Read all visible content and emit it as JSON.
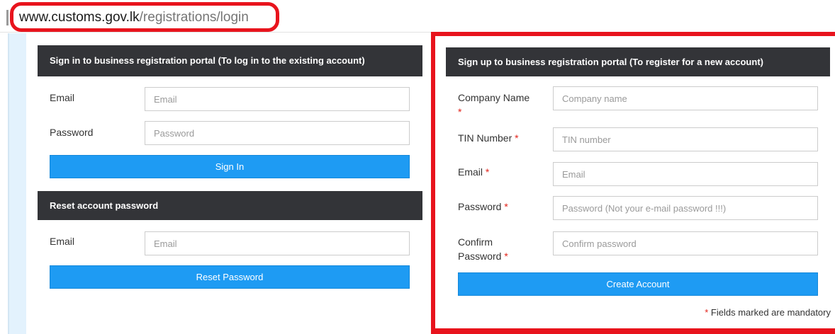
{
  "browser": {
    "url_host": "www.customs.gov.lk",
    "url_path": "/registrations/login"
  },
  "signin": {
    "title": "Sign in to business registration portal (To log in to the existing account)",
    "email_label": "Email",
    "email_placeholder": "Email",
    "password_label": "Password",
    "password_placeholder": "Password",
    "button": "Sign In"
  },
  "reset": {
    "title": "Reset account password",
    "email_label": "Email",
    "email_placeholder": "Email",
    "button": "Reset Password"
  },
  "signup": {
    "title": "Sign up to business registration portal (To register for a new account)",
    "required_mark": "*",
    "company_label": "Company Name",
    "company_placeholder": "Company name",
    "tin_label": "TIN Number",
    "tin_placeholder": "TIN number",
    "email_label": "Email",
    "email_placeholder": "Email",
    "password_label": "Password",
    "password_placeholder": "Password (Not your e-mail password !!!)",
    "confirm_label_line1": "Confirm",
    "confirm_label_line2": "Password",
    "confirm_placeholder": "Confirm password",
    "button": "Create Account",
    "mandatory_note": "Fields marked are mandatory"
  },
  "colors": {
    "header_bg": "#333438",
    "button_bg": "#1e9bf3",
    "highlight": "#e8141d",
    "required": "#e2231a"
  }
}
